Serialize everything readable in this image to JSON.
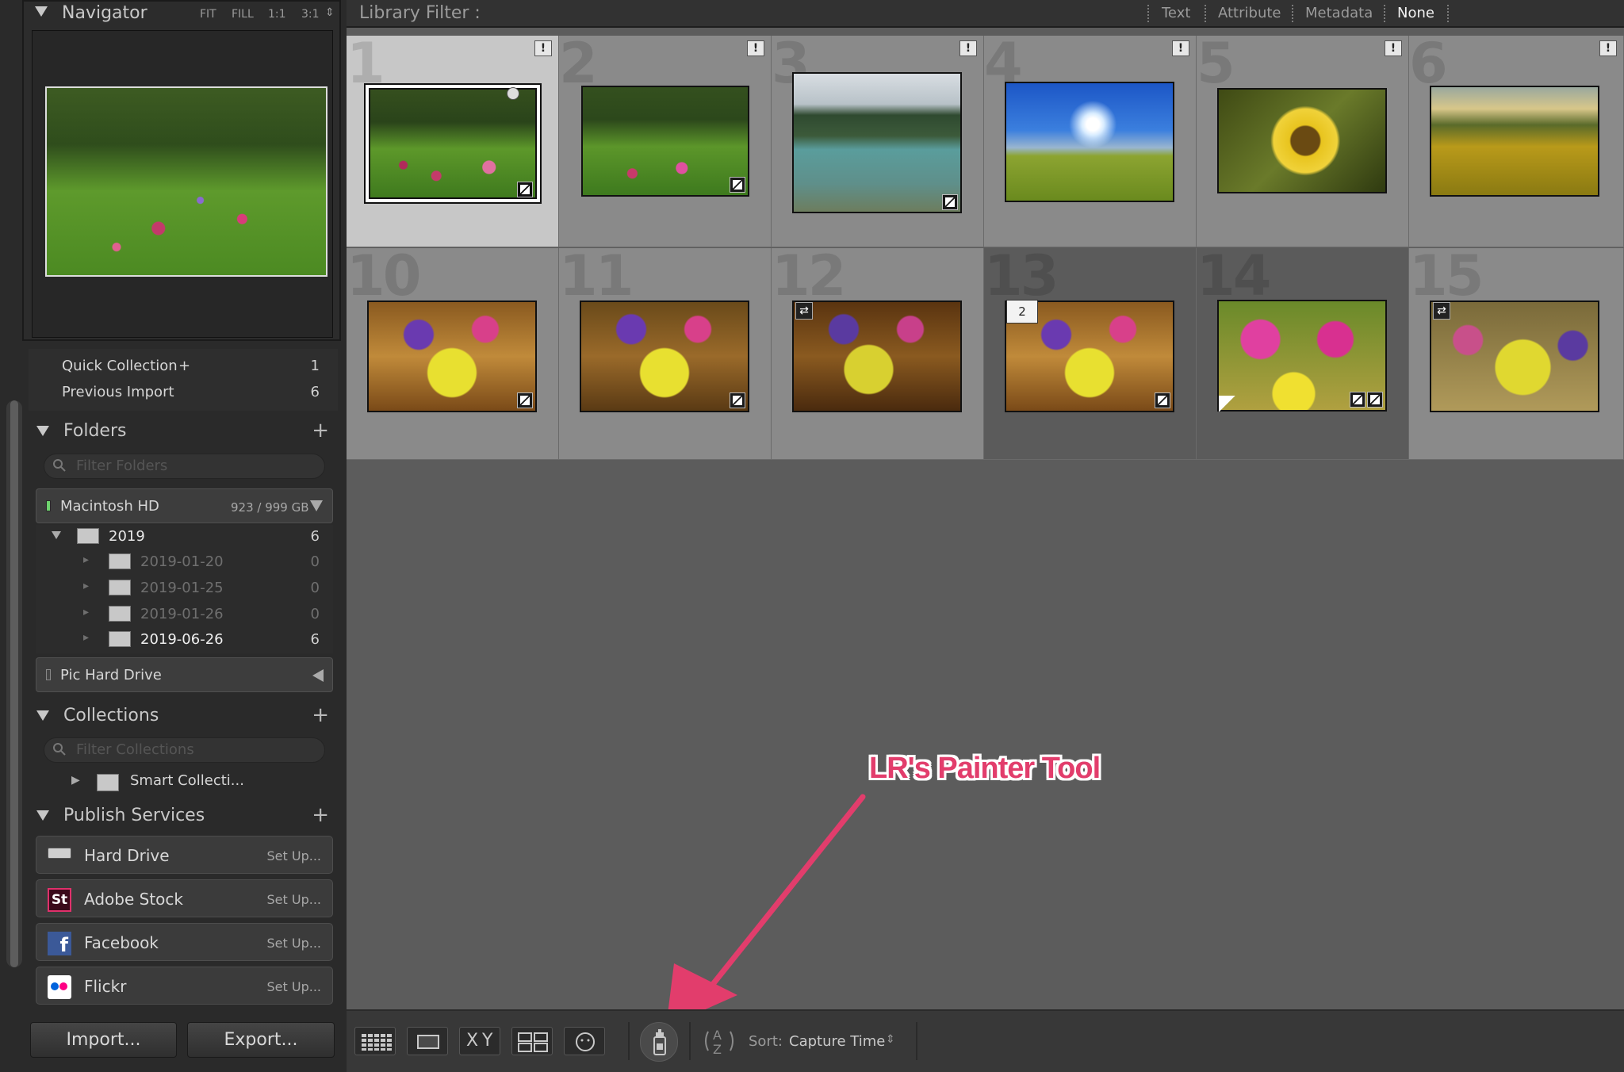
{
  "navigator": {
    "title": "Navigator",
    "zoom": [
      "FIT",
      "FILL",
      "1:1",
      "3:1"
    ]
  },
  "catalog": {
    "items": [
      {
        "label": "Quick Collection",
        "suffix": "+",
        "count": "1"
      },
      {
        "label": "Previous Import",
        "count": "6"
      }
    ]
  },
  "folders": {
    "title": "Folders",
    "filter_placeholder": "Filter Folders",
    "drive": {
      "name": "Macintosh HD",
      "usage": "923 / 999 GB"
    },
    "tree": [
      {
        "label": "2019",
        "count": "6",
        "active": true,
        "level": 1
      },
      {
        "label": "2019-01-20",
        "count": "0",
        "active": false,
        "level": 2
      },
      {
        "label": "2019-01-25",
        "count": "0",
        "active": false,
        "level": 2
      },
      {
        "label": "2019-01-26",
        "count": "0",
        "active": false,
        "level": 2
      },
      {
        "label": "2019-06-26",
        "count": "6",
        "active": true,
        "level": 2
      }
    ],
    "drive2": {
      "name": "Pic Hard Drive"
    }
  },
  "collections": {
    "title": "Collections",
    "filter_placeholder": "Filter Collections",
    "items": [
      {
        "label": "Smart Collecti..."
      }
    ]
  },
  "publish": {
    "title": "Publish Services",
    "items": [
      {
        "label": "Hard Drive",
        "action": "Set Up...",
        "icon": "hard-drive-icon"
      },
      {
        "label": "Adobe Stock",
        "action": "Set Up...",
        "icon": "adobe-stock-icon"
      },
      {
        "label": "Facebook",
        "action": "Set Up...",
        "icon": "facebook-icon"
      },
      {
        "label": "Flickr",
        "action": "Set Up...",
        "icon": "flickr-icon"
      }
    ]
  },
  "buttons": {
    "import": "Import...",
    "export": "Export..."
  },
  "library_filter": {
    "title": "Library Filter :",
    "options": [
      "Text",
      "Attribute",
      "Metadata",
      "None"
    ],
    "active": "None"
  },
  "grid": {
    "cells": [
      {
        "index": "1",
        "selected": true,
        "warn": true
      },
      {
        "index": "2",
        "warn": true
      },
      {
        "index": "3",
        "warn": true
      },
      {
        "index": "4",
        "warn": true
      },
      {
        "index": "5",
        "warn": true
      },
      {
        "index": "6",
        "warn": true
      },
      {
        "index": "10"
      },
      {
        "index": "11"
      },
      {
        "index": "12"
      },
      {
        "index": "13",
        "stack": "2"
      },
      {
        "index": "14"
      },
      {
        "index": "15"
      }
    ]
  },
  "toolbar": {
    "sort_label": "Sort:",
    "sort_value": "Capture Time",
    "compare_x": "X",
    "compare_y": "Y"
  },
  "annotation": {
    "text": "LR's Painter Tool"
  },
  "colors": {
    "accent": "#e23d6c",
    "panel": "#2a2a2a",
    "grid_bg": "#5c5c5c"
  }
}
